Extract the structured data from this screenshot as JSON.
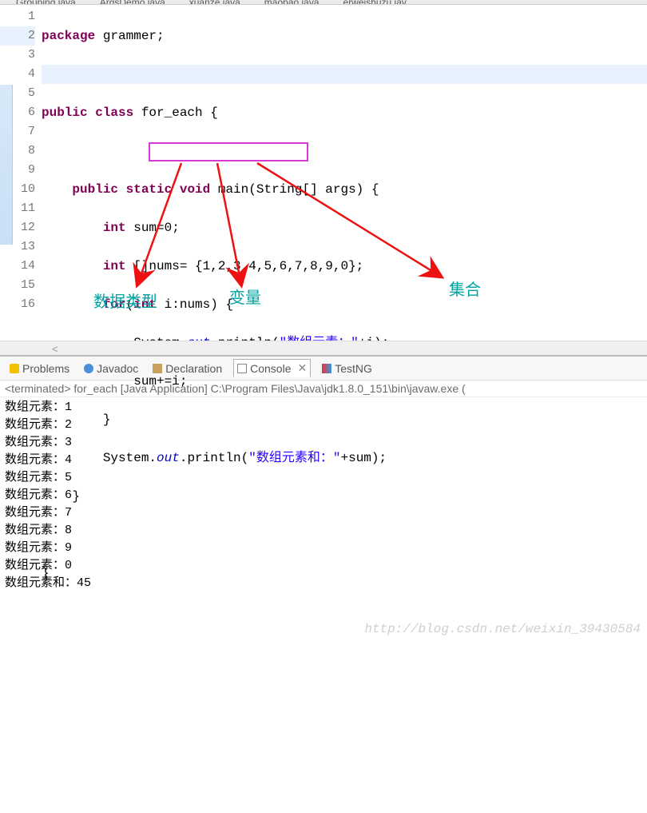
{
  "tabs": [
    {
      "label": "Grouping.java"
    },
    {
      "label": "ArgsDemo.java"
    },
    {
      "label": "xuanze.java"
    },
    {
      "label": "maopao.java"
    },
    {
      "label": "erweishuzu.jav"
    }
  ],
  "code": {
    "lines": [
      1,
      2,
      3,
      4,
      5,
      6,
      7,
      8,
      9,
      10,
      11,
      12,
      13,
      14,
      15,
      16
    ],
    "l1_pkg": "package",
    "l1_name": " grammer;",
    "l3_pub": "public",
    "l3_cls": " class",
    "l3_name": " for_each {",
    "l5_pub": "public",
    "l5_stat": " static",
    "l5_void": " void",
    "l5_rest": " main(String[] args) {",
    "l6_int": "int",
    "l6_rest": " sum=0;",
    "l7_int": "int",
    "l7_rest": " []nums= {1,2,3,4,5,6,7,8,9,0};",
    "l8_for": "for",
    "l8_paren1": "(",
    "l8_int": "int",
    "l8_rest": " i:nums) {",
    "l9_a": "System.",
    "l9_out": "out",
    "l9_b": ".println(",
    "l9_str": "\"数组元素：\"",
    "l9_c": "+i);",
    "l10": "sum+=i;",
    "l11": "}",
    "l12_a": "System.",
    "l12_out": "out",
    "l12_b": ".println(",
    "l12_str": "\"数组元素和：\"",
    "l12_c": "+sum);",
    "l13": "}",
    "l15": "}"
  },
  "annotations": {
    "a1": "数据类型",
    "a2": "变量",
    "a3": "集合"
  },
  "view_tabs": {
    "problems": "Problems",
    "javadoc": "Javadoc",
    "declaration": "Declaration",
    "console": "Console",
    "testng": "TestNG"
  },
  "console": {
    "header": "<terminated> for_each [Java Application] C:\\Program Files\\Java\\jdk1.8.0_151\\bin\\javaw.exe (",
    "lines": [
      "数组元素：1",
      "数组元素：2",
      "数组元素：3",
      "数组元素：4",
      "数组元素：5",
      "数组元素：6",
      "数组元素：7",
      "数组元素：8",
      "数组元素：9",
      "数组元素：0",
      "数组元素和：45"
    ]
  },
  "watermark": "http://blog.csdn.net/weixin_39430584"
}
